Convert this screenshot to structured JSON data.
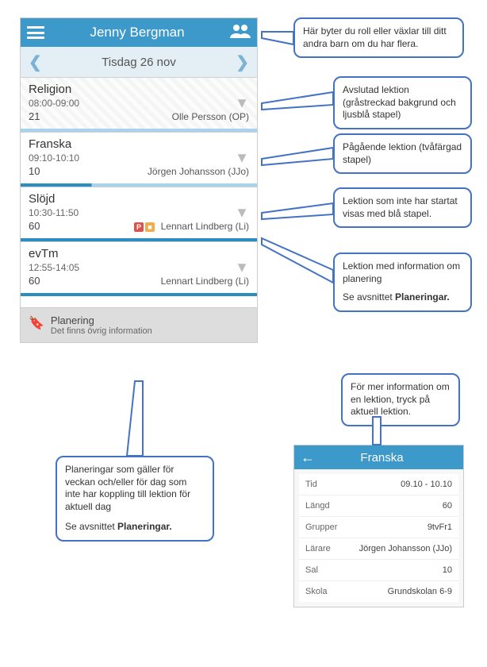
{
  "header": {
    "title": "Jenny Bergman"
  },
  "date": {
    "label": "Tisdag 26 nov"
  },
  "lessons": [
    {
      "subject": "Religion",
      "time": "08:00-09:00",
      "room": "21",
      "teacher": "Olle Persson (OP)",
      "state": "completed",
      "badges": []
    },
    {
      "subject": "Franska",
      "time": "09:10-10:10",
      "room": "10",
      "teacher": "Jörgen Johansson (JJo)",
      "state": "inprogress",
      "badges": []
    },
    {
      "subject": "Slöjd",
      "time": "10:30-11:50",
      "room": "60",
      "teacher": "Lennart Lindberg (Li)",
      "state": "upcoming",
      "badges": [
        "P",
        "Y"
      ]
    },
    {
      "subject": "evTm",
      "time": "12:55-14:05",
      "room": "60",
      "teacher": "Lennart Lindberg (Li)",
      "state": "upcoming",
      "badges": []
    }
  ],
  "planning": {
    "label": "Planering",
    "sub": "Det finns övrig information"
  },
  "callouts": {
    "role_switch": "Här byter du roll eller växlar till ditt andra barn om du har flera.",
    "completed": "Avslutad lektion (gråstreckad bakgrund och ljusblå stapel)",
    "inprogress": "Pågående lektion (tvåfärgad stapel)",
    "upcoming": "Lektion som inte har startat visas med blå stapel.",
    "planning_info_line1": "Lektion med information om planering",
    "planning_info_line2": "Se avsnittet ",
    "planning_info_bold": "Planeringar.",
    "weekly_line1": "Planeringar som gäller för veckan och/eller för dag som inte har koppling till lektion för aktuell dag",
    "weekly_line2": "Se avsnittet ",
    "weekly_bold": "Planeringar.",
    "more_info": "För mer information om en lektion, tryck på aktuell lektion."
  },
  "detail": {
    "title": "Franska",
    "rows": [
      {
        "label": "Tid",
        "value": "09.10 - 10.10"
      },
      {
        "label": "Längd",
        "value": "60"
      },
      {
        "label": "Grupper",
        "value": "9tvFr1"
      },
      {
        "label": "Lärare",
        "value": "Jörgen Johansson (JJo)"
      },
      {
        "label": "Sal",
        "value": "10"
      },
      {
        "label": "Skola",
        "value": "Grundskolan 6-9"
      }
    ]
  }
}
